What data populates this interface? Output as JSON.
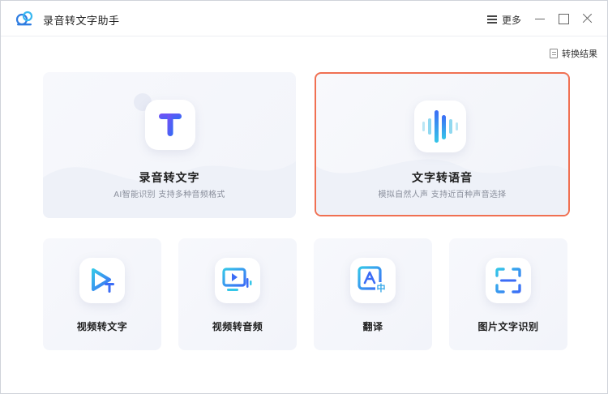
{
  "app": {
    "title": "录音转文字助手",
    "more_label": "更多"
  },
  "toolbar": {
    "results_label": "转换结果"
  },
  "features": {
    "record_to_text": {
      "title": "录音转文字",
      "subtitle": "AI智能识别 支持多种音频格式",
      "icon": "letter-t-icon"
    },
    "text_to_speech": {
      "title": "文字转语音",
      "subtitle": "模拟自然人声 支持近百种声音选择",
      "icon": "sound-wave-icon",
      "selected": true
    },
    "video_to_text": {
      "title": "视频转文字",
      "icon": "video-text-icon"
    },
    "video_to_audio": {
      "title": "视频转音频",
      "icon": "video-audio-icon"
    },
    "translate": {
      "title": "翻译",
      "icon": "translate-icon"
    },
    "image_to_text": {
      "title": "图片文字识别",
      "icon": "scan-icon"
    }
  },
  "colors": {
    "accent_blue": "#3b6cf6",
    "accent_cyan": "#35c6e8",
    "selection_border": "#f07052"
  }
}
